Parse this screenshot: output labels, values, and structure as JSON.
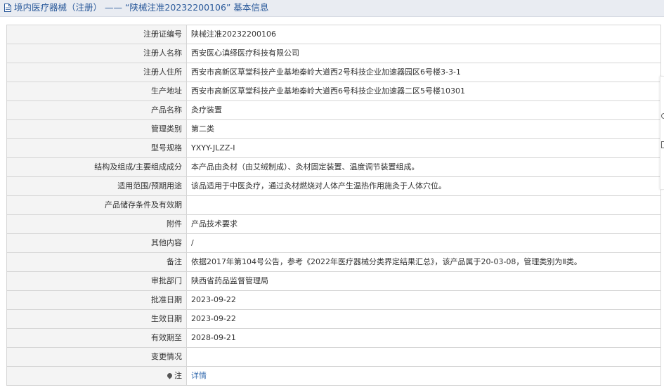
{
  "header": {
    "title": "境内医疗器械（注册） —— “陕械注准20232200106” 基本信息",
    "icon": "document-icon"
  },
  "rows": [
    {
      "label": "注册证编号",
      "value": "陕械注准20232200106"
    },
    {
      "label": "注册人名称",
      "value": "西安医心滇绎医疗科技有限公司"
    },
    {
      "label": "注册人住所",
      "value": "西安市高新区草堂科技产业基地秦岭大道西2号科技企业加速器园区6号楼3-3-1"
    },
    {
      "label": "生产地址",
      "value": "西安市高新区草堂科技产业基地秦岭大道西6号科技企业加速器二区5号楼10301"
    },
    {
      "label": "产品名称",
      "value": "灸疗装置"
    },
    {
      "label": "管理类别",
      "value": "第二类"
    },
    {
      "label": "型号规格",
      "value": "YXYY-JLZZ-Ⅰ"
    },
    {
      "label": "结构及组成/主要组成成分",
      "value": "本产品由灸材（由艾绒制成）、灸材固定装置、温度调节装置组成。"
    },
    {
      "label": "适用范围/预期用途",
      "value": "该品适用于中医灸疗，通过灸材燃烧对人体产生温热作用施灸于人体穴位。"
    },
    {
      "label": "产品储存条件及有效期",
      "value": ""
    },
    {
      "label": "附件",
      "value": "产品技术要求"
    },
    {
      "label": "其他内容",
      "value": "/"
    },
    {
      "label": "备注",
      "value": "依据2017年第104号公告，参考《2022年医疗器械分类界定结果汇总》，该产品属于20-03-08，管理类别为Ⅱ类。"
    },
    {
      "label": "审批部门",
      "value": "陕西省药品监督管理局"
    },
    {
      "label": "批准日期",
      "value": "2023-09-22"
    },
    {
      "label": "生效日期",
      "value": "2023-09-22"
    },
    {
      "label": "有效期至",
      "value": "2028-09-21"
    },
    {
      "label": "变更情况",
      "value": ""
    }
  ],
  "note_row": {
    "label": "注",
    "icon": "pin-icon",
    "link_text": "详情"
  },
  "colors": {
    "title_bar": "#e9ecf2",
    "title_text": "#2b5a9b",
    "label_bg": "#f4f4f4",
    "border": "#d6d6d6",
    "link": "#3a6fb0"
  }
}
